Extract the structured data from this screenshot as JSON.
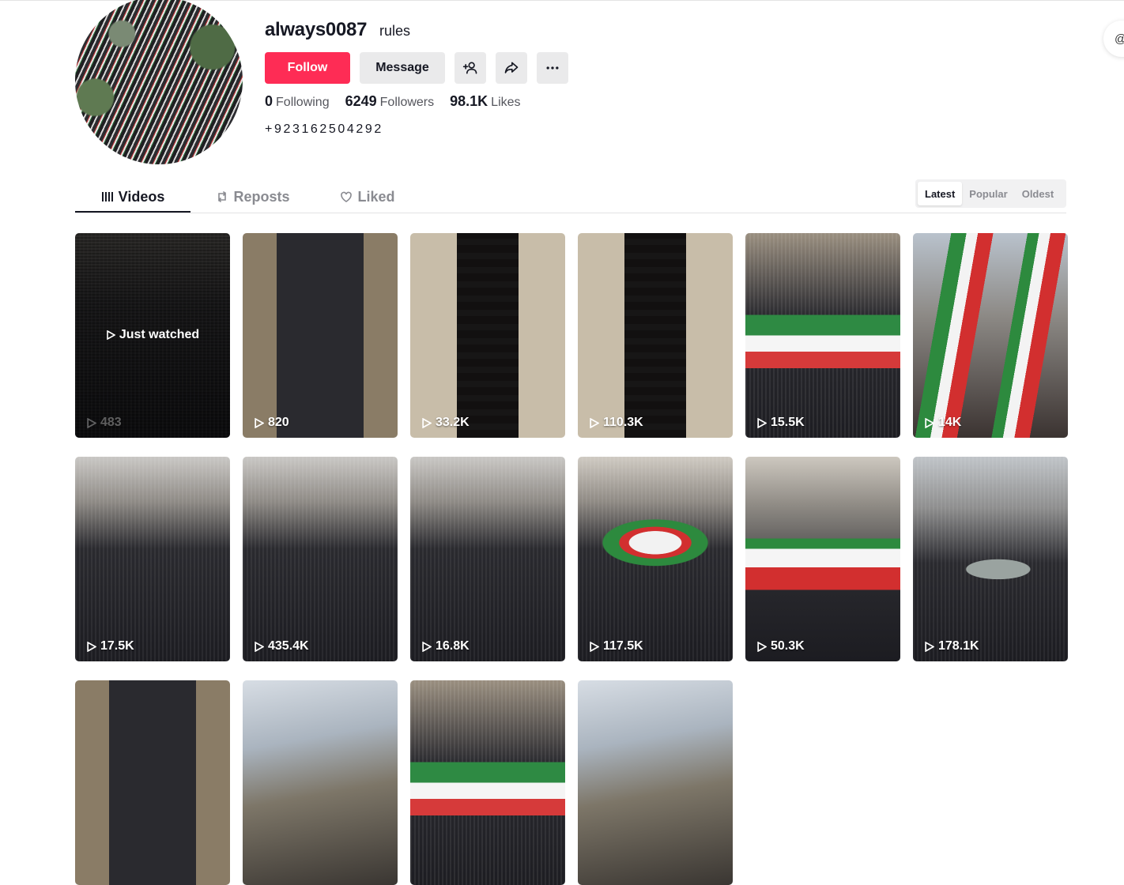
{
  "profile": {
    "username": "always0087",
    "nickname": "rules",
    "follow_label": "Follow",
    "message_label": "Message",
    "following_count": "0",
    "following_label": "Following",
    "followers_count": "6249",
    "followers_label": "Followers",
    "likes_count": "98.1K",
    "likes_label": "Likes",
    "bio": "+923162504292"
  },
  "tabs": {
    "videos": "Videos",
    "reposts": "Reposts",
    "liked": "Liked"
  },
  "sort": {
    "latest": "Latest",
    "popular": "Popular",
    "oldest": "Oldest",
    "selected": "Latest"
  },
  "videos": [
    {
      "views": "483",
      "overlay": "Just watched"
    },
    {
      "views": "820"
    },
    {
      "views": "33.2K"
    },
    {
      "views": "110.3K"
    },
    {
      "views": "15.5K"
    },
    {
      "views": "14K"
    },
    {
      "views": "17.5K"
    },
    {
      "views": "435.4K"
    },
    {
      "views": "16.8K"
    },
    {
      "views": "117.5K"
    },
    {
      "views": "50.3K"
    },
    {
      "views": "178.1K"
    },
    {
      "views": ""
    },
    {
      "views": ""
    },
    {
      "views": ""
    },
    {
      "views": ""
    }
  ],
  "colors": {
    "accent": "#fe2c55",
    "text": "#161823",
    "muted": "#8a8b91"
  }
}
